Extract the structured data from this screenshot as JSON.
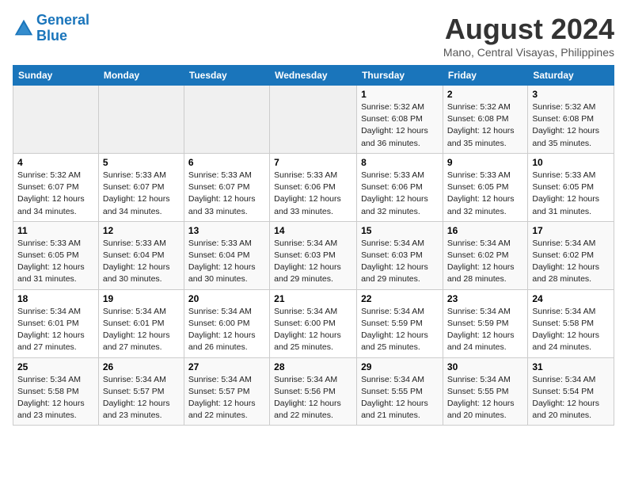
{
  "header": {
    "logo_line1": "General",
    "logo_line2": "Blue",
    "month_year": "August 2024",
    "location": "Mano, Central Visayas, Philippines"
  },
  "days_of_week": [
    "Sunday",
    "Monday",
    "Tuesday",
    "Wednesday",
    "Thursday",
    "Friday",
    "Saturday"
  ],
  "weeks": [
    [
      {
        "day": "",
        "sunrise": "",
        "sunset": "",
        "daylight": "",
        "empty": true
      },
      {
        "day": "",
        "sunrise": "",
        "sunset": "",
        "daylight": "",
        "empty": true
      },
      {
        "day": "",
        "sunrise": "",
        "sunset": "",
        "daylight": "",
        "empty": true
      },
      {
        "day": "",
        "sunrise": "",
        "sunset": "",
        "daylight": "",
        "empty": true
      },
      {
        "day": "1",
        "sunrise": "Sunrise: 5:32 AM",
        "sunset": "Sunset: 6:08 PM",
        "daylight": "Daylight: 12 hours and 36 minutes."
      },
      {
        "day": "2",
        "sunrise": "Sunrise: 5:32 AM",
        "sunset": "Sunset: 6:08 PM",
        "daylight": "Daylight: 12 hours and 35 minutes."
      },
      {
        "day": "3",
        "sunrise": "Sunrise: 5:32 AM",
        "sunset": "Sunset: 6:08 PM",
        "daylight": "Daylight: 12 hours and 35 minutes."
      }
    ],
    [
      {
        "day": "4",
        "sunrise": "Sunrise: 5:32 AM",
        "sunset": "Sunset: 6:07 PM",
        "daylight": "Daylight: 12 hours and 34 minutes."
      },
      {
        "day": "5",
        "sunrise": "Sunrise: 5:33 AM",
        "sunset": "Sunset: 6:07 PM",
        "daylight": "Daylight: 12 hours and 34 minutes."
      },
      {
        "day": "6",
        "sunrise": "Sunrise: 5:33 AM",
        "sunset": "Sunset: 6:07 PM",
        "daylight": "Daylight: 12 hours and 33 minutes."
      },
      {
        "day": "7",
        "sunrise": "Sunrise: 5:33 AM",
        "sunset": "Sunset: 6:06 PM",
        "daylight": "Daylight: 12 hours and 33 minutes."
      },
      {
        "day": "8",
        "sunrise": "Sunrise: 5:33 AM",
        "sunset": "Sunset: 6:06 PM",
        "daylight": "Daylight: 12 hours and 32 minutes."
      },
      {
        "day": "9",
        "sunrise": "Sunrise: 5:33 AM",
        "sunset": "Sunset: 6:05 PM",
        "daylight": "Daylight: 12 hours and 32 minutes."
      },
      {
        "day": "10",
        "sunrise": "Sunrise: 5:33 AM",
        "sunset": "Sunset: 6:05 PM",
        "daylight": "Daylight: 12 hours and 31 minutes."
      }
    ],
    [
      {
        "day": "11",
        "sunrise": "Sunrise: 5:33 AM",
        "sunset": "Sunset: 6:05 PM",
        "daylight": "Daylight: 12 hours and 31 minutes."
      },
      {
        "day": "12",
        "sunrise": "Sunrise: 5:33 AM",
        "sunset": "Sunset: 6:04 PM",
        "daylight": "Daylight: 12 hours and 30 minutes."
      },
      {
        "day": "13",
        "sunrise": "Sunrise: 5:33 AM",
        "sunset": "Sunset: 6:04 PM",
        "daylight": "Daylight: 12 hours and 30 minutes."
      },
      {
        "day": "14",
        "sunrise": "Sunrise: 5:34 AM",
        "sunset": "Sunset: 6:03 PM",
        "daylight": "Daylight: 12 hours and 29 minutes."
      },
      {
        "day": "15",
        "sunrise": "Sunrise: 5:34 AM",
        "sunset": "Sunset: 6:03 PM",
        "daylight": "Daylight: 12 hours and 29 minutes."
      },
      {
        "day": "16",
        "sunrise": "Sunrise: 5:34 AM",
        "sunset": "Sunset: 6:02 PM",
        "daylight": "Daylight: 12 hours and 28 minutes."
      },
      {
        "day": "17",
        "sunrise": "Sunrise: 5:34 AM",
        "sunset": "Sunset: 6:02 PM",
        "daylight": "Daylight: 12 hours and 28 minutes."
      }
    ],
    [
      {
        "day": "18",
        "sunrise": "Sunrise: 5:34 AM",
        "sunset": "Sunset: 6:01 PM",
        "daylight": "Daylight: 12 hours and 27 minutes."
      },
      {
        "day": "19",
        "sunrise": "Sunrise: 5:34 AM",
        "sunset": "Sunset: 6:01 PM",
        "daylight": "Daylight: 12 hours and 27 minutes."
      },
      {
        "day": "20",
        "sunrise": "Sunrise: 5:34 AM",
        "sunset": "Sunset: 6:00 PM",
        "daylight": "Daylight: 12 hours and 26 minutes."
      },
      {
        "day": "21",
        "sunrise": "Sunrise: 5:34 AM",
        "sunset": "Sunset: 6:00 PM",
        "daylight": "Daylight: 12 hours and 25 minutes."
      },
      {
        "day": "22",
        "sunrise": "Sunrise: 5:34 AM",
        "sunset": "Sunset: 5:59 PM",
        "daylight": "Daylight: 12 hours and 25 minutes."
      },
      {
        "day": "23",
        "sunrise": "Sunrise: 5:34 AM",
        "sunset": "Sunset: 5:59 PM",
        "daylight": "Daylight: 12 hours and 24 minutes."
      },
      {
        "day": "24",
        "sunrise": "Sunrise: 5:34 AM",
        "sunset": "Sunset: 5:58 PM",
        "daylight": "Daylight: 12 hours and 24 minutes."
      }
    ],
    [
      {
        "day": "25",
        "sunrise": "Sunrise: 5:34 AM",
        "sunset": "Sunset: 5:58 PM",
        "daylight": "Daylight: 12 hours and 23 minutes."
      },
      {
        "day": "26",
        "sunrise": "Sunrise: 5:34 AM",
        "sunset": "Sunset: 5:57 PM",
        "daylight": "Daylight: 12 hours and 23 minutes."
      },
      {
        "day": "27",
        "sunrise": "Sunrise: 5:34 AM",
        "sunset": "Sunset: 5:57 PM",
        "daylight": "Daylight: 12 hours and 22 minutes."
      },
      {
        "day": "28",
        "sunrise": "Sunrise: 5:34 AM",
        "sunset": "Sunset: 5:56 PM",
        "daylight": "Daylight: 12 hours and 22 minutes."
      },
      {
        "day": "29",
        "sunrise": "Sunrise: 5:34 AM",
        "sunset": "Sunset: 5:55 PM",
        "daylight": "Daylight: 12 hours and 21 minutes."
      },
      {
        "day": "30",
        "sunrise": "Sunrise: 5:34 AM",
        "sunset": "Sunset: 5:55 PM",
        "daylight": "Daylight: 12 hours and 20 minutes."
      },
      {
        "day": "31",
        "sunrise": "Sunrise: 5:34 AM",
        "sunset": "Sunset: 5:54 PM",
        "daylight": "Daylight: 12 hours and 20 minutes."
      }
    ]
  ]
}
